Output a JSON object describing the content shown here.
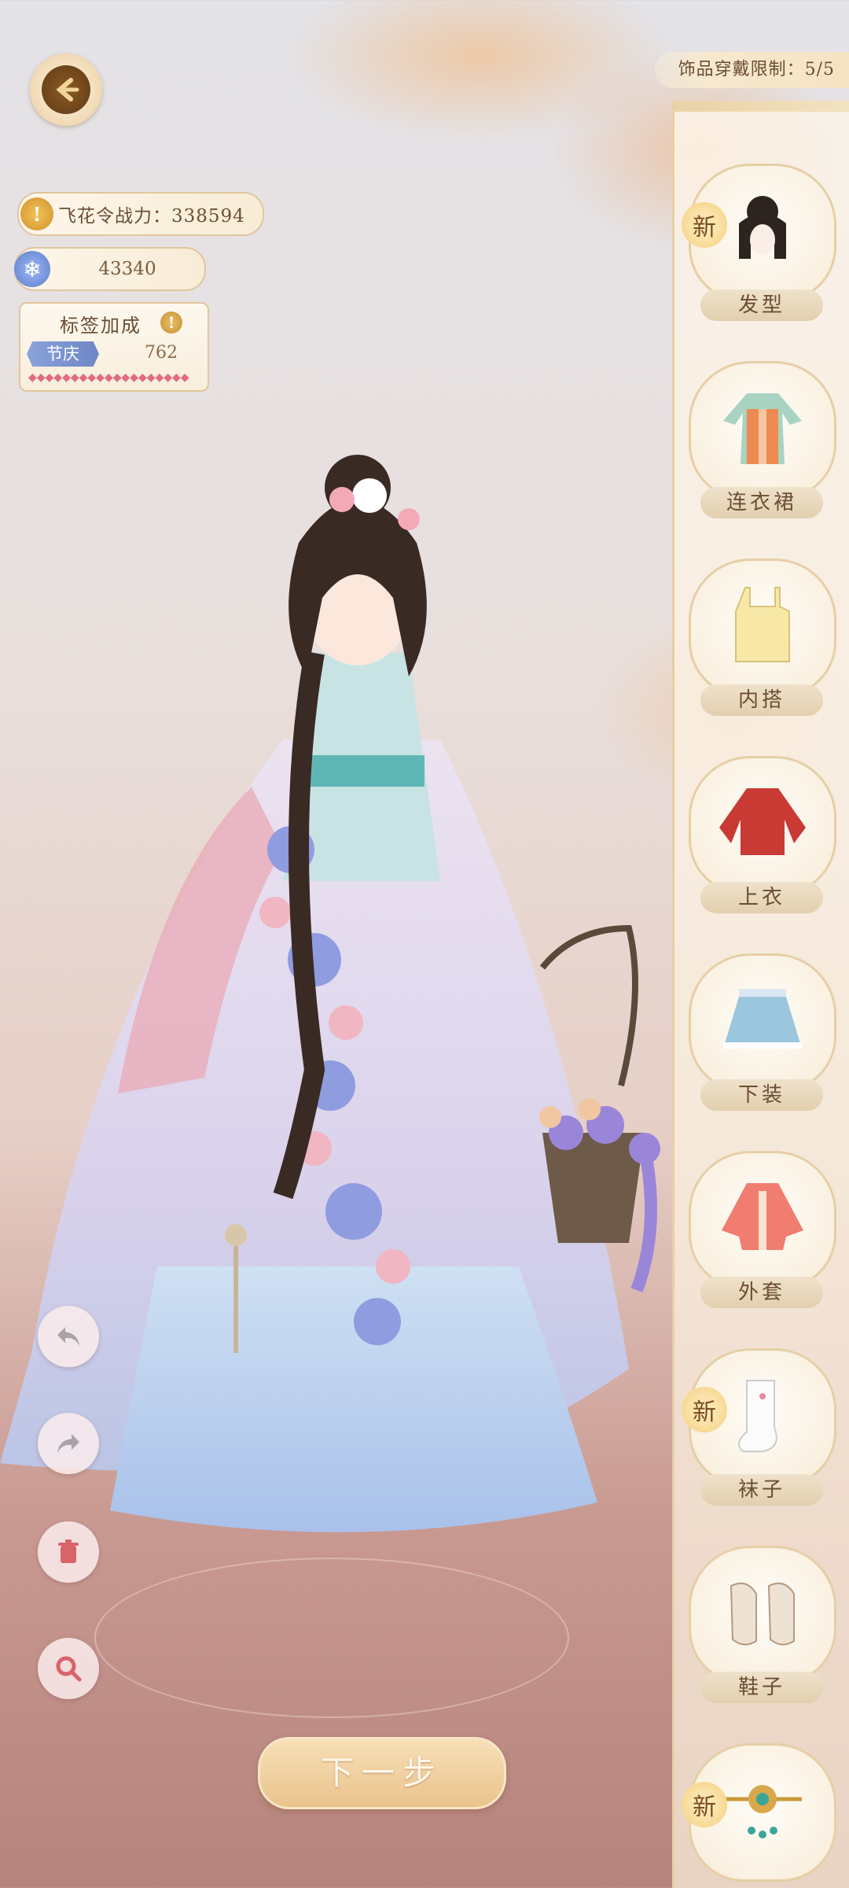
{
  "header": {
    "accessory_limit": "饰品穿戴限制：5/5"
  },
  "stats": {
    "power_label": "飞花令战力：338594",
    "gems": "43340",
    "tag_bonus_title": "标签加成",
    "tag_name": "节庆",
    "tag_value": "762",
    "tag_dots": "◆◆◆◆◆◆◆◆◆◆◆◆◆◆◆◆◆◆◆"
  },
  "categories": [
    {
      "label": "发型",
      "icon": "hairstyle-icon",
      "new": true
    },
    {
      "label": "连衣裙",
      "icon": "dress-icon",
      "new": false
    },
    {
      "label": "内搭",
      "icon": "inner-wear-icon",
      "new": false
    },
    {
      "label": "上衣",
      "icon": "top-icon",
      "new": false
    },
    {
      "label": "下装",
      "icon": "skirt-icon",
      "new": false
    },
    {
      "label": "外套",
      "icon": "coat-icon",
      "new": false
    },
    {
      "label": "袜子",
      "icon": "socks-icon",
      "new": true
    },
    {
      "label": "鞋子",
      "icon": "shoes-icon",
      "new": false
    },
    {
      "label": "",
      "icon": "hairpin-icon",
      "new": true
    }
  ],
  "new_badge": "新",
  "next_button": "下一步",
  "colors": {
    "accent_gold": "#e6cfa6",
    "text_brown": "#6b4e33",
    "tag_blue": "#8ba3db",
    "heart_pink": "#e26b7c"
  }
}
